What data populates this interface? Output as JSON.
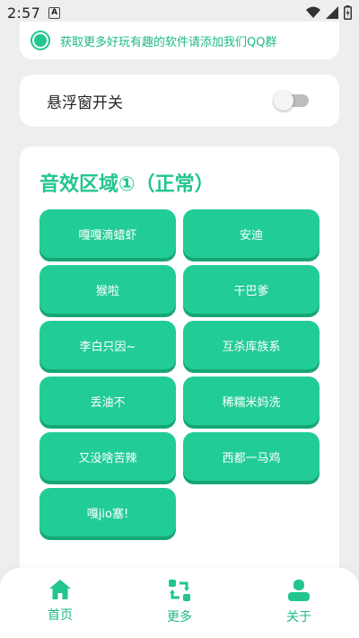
{
  "status": {
    "time": "2:57",
    "notif": "A"
  },
  "qq_notice": {
    "text": "获取更多好玩有趣的软件请添加我们QQ群"
  },
  "floating_window": {
    "label": "悬浮窗开关",
    "enabled": false
  },
  "sound_section": {
    "title": "音效区域①（正常）",
    "buttons": [
      "嘎嘎滴蜡虾",
      "安迪",
      "猴啦",
      "干巴爹",
      "李白只因~",
      "互杀库族系",
      "丢油不",
      "稀糯米妈洗",
      "又没啥苦辣",
      "西都一马鸡",
      "嘎jio塞!"
    ]
  },
  "bottom_nav": {
    "items": [
      {
        "label": "首页",
        "icon": "home-icon"
      },
      {
        "label": "更多",
        "icon": "swap-icon"
      },
      {
        "label": "关于",
        "icon": "person-icon"
      }
    ]
  },
  "colors": {
    "accent": "#22c590",
    "button": "#22cc96",
    "button_shadow": "#16a678"
  }
}
